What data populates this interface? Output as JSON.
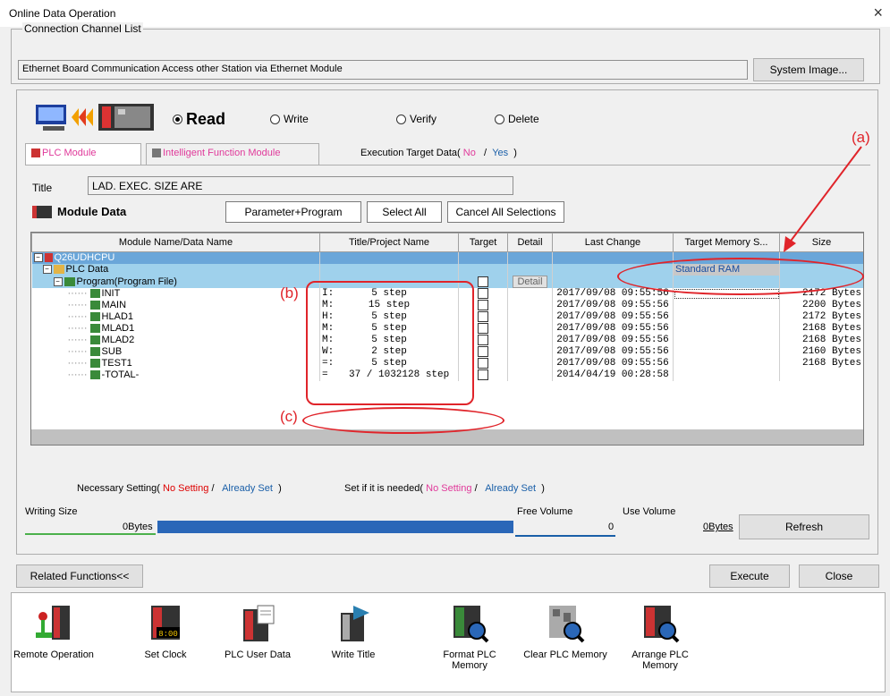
{
  "window": {
    "title": "Online Data Operation",
    "close": "×"
  },
  "connection": {
    "legend": "Connection Channel List",
    "value": "Ethernet Board Communication  Access other Station via Ethernet Module",
    "system_image": "System Image..."
  },
  "modes": {
    "read": "Read",
    "write": "Write",
    "verify": "Verify",
    "delete": "Delete"
  },
  "tabs": {
    "plc": "PLC Module",
    "intelligent": "Intelligent Function Module"
  },
  "exec_target": {
    "label": "Execution Target Data(",
    "no": "No",
    "slash": "/",
    "yes": "Yes",
    "close": ")"
  },
  "title_field": {
    "label": "Title",
    "value": "LAD. EXEC. SIZE ARE"
  },
  "module_data": {
    "label": "Module Data",
    "param_prog": "Parameter+Program",
    "select_all": "Select All",
    "cancel_all": "Cancel All Selections"
  },
  "table": {
    "headers": [
      "Module Name/Data Name",
      "Title/Project Name",
      "Target",
      "Detail",
      "Last Change",
      "Target Memory S...",
      "Size"
    ],
    "root": "Q26UDHCPU",
    "plc_data": "PLC Data",
    "memory": "Standard RAM",
    "program_file": "Program(Program File)",
    "detail_btn": "Detail",
    "rows": [
      {
        "name": "INIT",
        "prefix": "I:",
        "title": "5 step",
        "change": "2017/09/08 09:55:56",
        "size": "2172 Bytes"
      },
      {
        "name": "MAIN",
        "prefix": "M:",
        "title": "15 step",
        "change": "2017/09/08 09:55:56",
        "size": "2200 Bytes"
      },
      {
        "name": "HLAD1",
        "prefix": "H:",
        "title": "5 step",
        "change": "2017/09/08 09:55:56",
        "size": "2172 Bytes"
      },
      {
        "name": "MLAD1",
        "prefix": "M:",
        "title": "5 step",
        "change": "2017/09/08 09:55:56",
        "size": "2168 Bytes"
      },
      {
        "name": "MLAD2",
        "prefix": "M:",
        "title": "5 step",
        "change": "2017/09/08 09:55:56",
        "size": "2168 Bytes"
      },
      {
        "name": "SUB",
        "prefix": "W:",
        "title": "2 step",
        "change": "2017/09/08 09:55:56",
        "size": "2160 Bytes"
      },
      {
        "name": "TEST1",
        "prefix": "=:",
        "title": "5 step",
        "change": "2017/09/08 09:55:56",
        "size": "2168 Bytes"
      },
      {
        "name": "-TOTAL-",
        "prefix": "=",
        "title": "37 / 1032128 step",
        "change": "2014/04/19 00:28:58",
        "size": ""
      }
    ]
  },
  "legend_status": {
    "necessary": "Necessary Setting(",
    "no_setting": "No Setting",
    "slash": "/",
    "already_set": "Already Set",
    "close": ")",
    "if_needed": "Set if it is needed(",
    "no_setting2": "No Setting",
    "already_set2": "Already Set"
  },
  "size": {
    "writing": "Writing Size",
    "writing_value": "0Bytes",
    "free": "Free Volume",
    "free_value": "0",
    "use": "Use Volume",
    "use_value": "0Bytes",
    "refresh": "Refresh"
  },
  "bottom": {
    "related": "Related Functions<<",
    "execute": "Execute",
    "close": "Close"
  },
  "functions": [
    {
      "label": "Remote Operation"
    },
    {
      "label": "Set Clock",
      "clock": "8:00"
    },
    {
      "label": "PLC User Data"
    },
    {
      "label": "Write Title"
    },
    {
      "label": "Format PLC Memory"
    },
    {
      "label": "Clear PLC Memory"
    },
    {
      "label": "Arrange PLC Memory"
    }
  ],
  "annotations": {
    "a": "(a)",
    "b": "(b)",
    "c": "(c)"
  },
  "colors": {
    "annotation": "#e0242a",
    "selected_row": "#6aa6d9",
    "sub_row": "#9fd1ec",
    "bar": "#2a67b8"
  }
}
